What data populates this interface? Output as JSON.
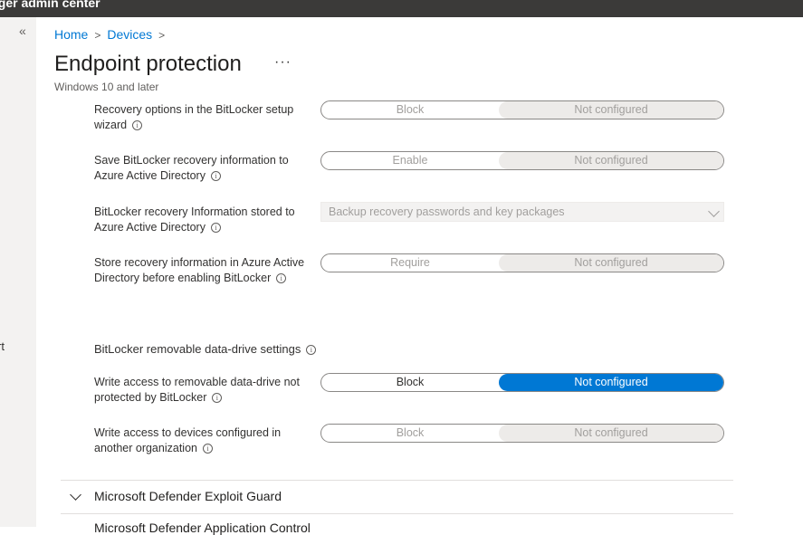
{
  "app": {
    "title": "ager admin center"
  },
  "nav": {
    "collapse_glyph": "«",
    "fragment": "rt"
  },
  "breadcrumb": {
    "home": "Home",
    "devices": "Devices",
    "sep": ">"
  },
  "page": {
    "title": "Endpoint protection",
    "more": "···",
    "subtitle": "Windows 10 and later"
  },
  "settings": {
    "recovery_options": {
      "label": "Recovery options in the BitLocker setup wizard",
      "left": "Block",
      "right": "Not configured"
    },
    "save_recovery": {
      "label": "Save BitLocker recovery information to Azure Active Directory",
      "left": "Enable",
      "right": "Not configured"
    },
    "recovery_stored": {
      "label": "BitLocker recovery Information stored to Azure Active Directory",
      "value": "Backup recovery passwords and key packages"
    },
    "store_before": {
      "label": "Store recovery information in Azure Active Directory before enabling BitLocker",
      "left": "Require",
      "right": "Not configured"
    },
    "removable_header": "BitLocker removable data-drive settings",
    "write_access": {
      "label": "Write access to removable data-drive not protected by BitLocker",
      "left": "Block",
      "right": "Not configured"
    },
    "write_devices": {
      "label": "Write access to devices configured in another organization",
      "left": "Block",
      "right": "Not configured"
    }
  },
  "sections": {
    "exploit_guard": "Microsoft Defender Exploit Guard",
    "next_partial": "Microsoft Defender Application Control"
  },
  "colors": {
    "accent": "#0078d4",
    "topbar": "#3b3a39"
  },
  "icons": {
    "info": "info-icon",
    "chevron": "chevron-down-icon"
  }
}
